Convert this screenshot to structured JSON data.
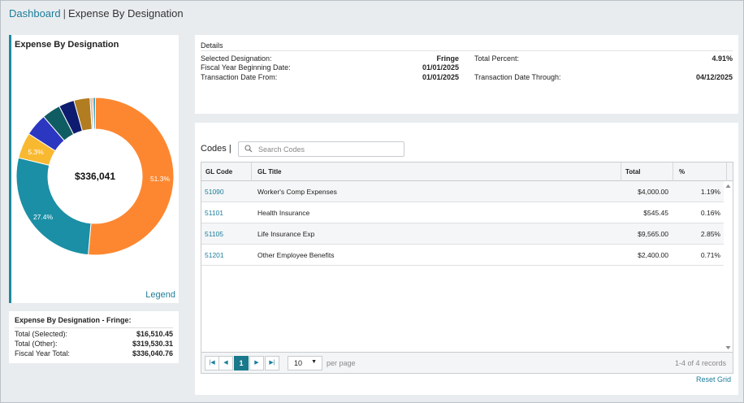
{
  "breadcrumb": {
    "home": "Dashboard",
    "separator": "|",
    "current": "Expense By Designation"
  },
  "chart": {
    "title": "Expense By Designation",
    "center_label": "$336,041",
    "legend_link": "Legend",
    "slice_labels": {
      "fringe": "51.3%",
      "second": "27.4%",
      "third": "5.3%"
    }
  },
  "chart_data": {
    "type": "pie",
    "title": "Expense By Designation",
    "center_label": "$336,041",
    "slices": [
      {
        "label": "51.3%",
        "value": 51.3,
        "color": "#fd8730"
      },
      {
        "label": "27.4%",
        "value": 27.4,
        "color": "#1b8fa5"
      },
      {
        "label": "5.3%",
        "value": 5.3,
        "color": "#f8b931"
      },
      {
        "label": "",
        "value": 4.6,
        "color": "#2b36c1"
      },
      {
        "label": "",
        "value": 3.8,
        "color": "#105c63"
      },
      {
        "label": "",
        "value": 3.2,
        "color": "#0e1c6f"
      },
      {
        "label": "",
        "value": 3.3,
        "color": "#b27c20"
      },
      {
        "label": "",
        "value": 0.4,
        "color": "#b2b2b2"
      },
      {
        "label": "",
        "value": 0.3,
        "color": "#e05030"
      },
      {
        "label": "",
        "value": 0.4,
        "color": "#1b8fa5"
      }
    ]
  },
  "summary": {
    "title": "Expense By Designation - Fringe:",
    "rows": [
      {
        "label": "Total (Selected):",
        "value": "$16,510.45"
      },
      {
        "label": "Total (Other):",
        "value": "$319,530.31"
      },
      {
        "label": "Fiscal Year Total:",
        "value": "$336,040.76"
      }
    ]
  },
  "details": {
    "heading": "Details",
    "selected_designation_label": "Selected Designation:",
    "selected_designation": "Fringe",
    "fy_begin_label": "Fiscal Year Beginning Date:",
    "fy_begin": "01/01/2025",
    "txn_from_label": "Transaction Date From:",
    "txn_from": "01/01/2025",
    "total_percent_label": "Total Percent:",
    "total_percent": "4.91%",
    "txn_through_label": "Transaction Date Through:",
    "txn_through": "04/12/2025"
  },
  "codes": {
    "label": "Codes |",
    "search_placeholder": "Search Codes",
    "columns": [
      "GL Code",
      "GL Title",
      "Total",
      "%"
    ],
    "rows": [
      {
        "code": "51090",
        "title": "Worker's Comp Expenses",
        "total": "$4,000.00",
        "pct": "1.19%"
      },
      {
        "code": "51101",
        "title": "Health Insurance",
        "total": "$545.45",
        "pct": "0.16%"
      },
      {
        "code": "51105",
        "title": "Life Insurance Exp",
        "total": "$9,565.00",
        "pct": "2.85%"
      },
      {
        "code": "51201",
        "title": "Other Employee Benefits",
        "total": "$2,400.00",
        "pct": "0.71%"
      }
    ],
    "pager": {
      "current_page": "1",
      "page_size": "10",
      "per_page_label": "per page",
      "records": "1-4 of 4 records"
    },
    "reset_label": "Reset Grid"
  },
  "colors": {
    "accent": "#1d7d9a",
    "active_page": "#1a7a8c"
  },
  "icons": {
    "search": "search-icon",
    "first": "first-page-icon",
    "prev": "prev-page-icon",
    "next": "next-page-icon",
    "last": "last-page-icon",
    "dropdown": "chevron-down-icon",
    "scroll_up": "scroll-up-icon",
    "scroll_down": "scroll-down-icon"
  }
}
